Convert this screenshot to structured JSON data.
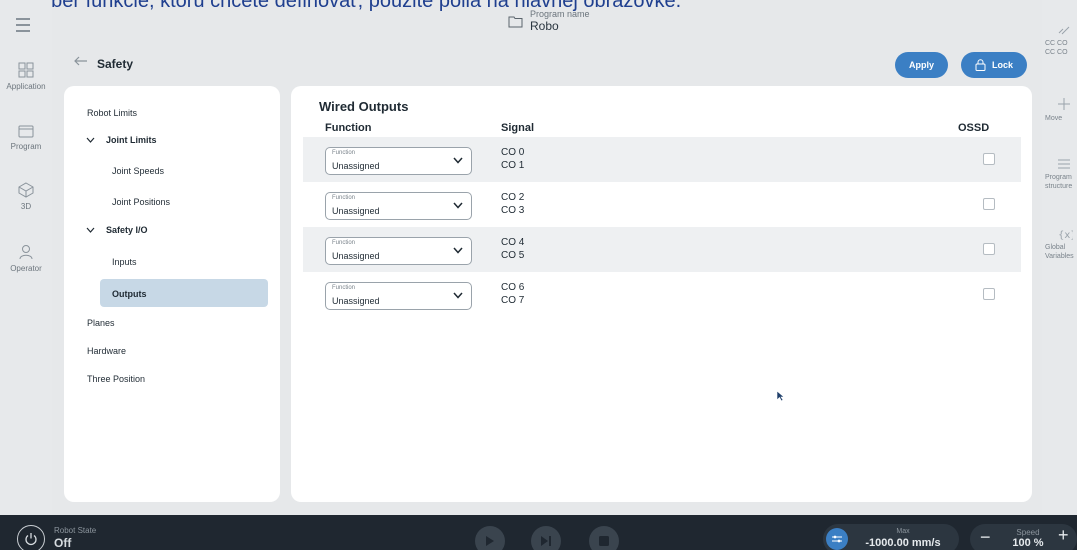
{
  "caption": "Na výber funkcie, ktorú chcete definovať, použite polia na hlavnej obrazovke.",
  "left_nav": {
    "items": [
      {
        "label": "Application",
        "icon": "grid-icon"
      },
      {
        "label": "Program",
        "icon": "folder-icon"
      },
      {
        "label": "3D",
        "icon": "cube-icon"
      },
      {
        "label": "Operator",
        "icon": "person-icon"
      }
    ]
  },
  "right_nav": {
    "items": [
      {
        "label": "CC CO\nCC CO",
        "icon": "link-icon"
      },
      {
        "label": "Move",
        "icon": "move-icon"
      },
      {
        "label": "Program\nstructure",
        "icon": "list-icon"
      },
      {
        "label": "Global\nVariables",
        "icon": "variable-icon"
      }
    ]
  },
  "program": {
    "label": "Program name",
    "value": "Robo"
  },
  "header": {
    "title": "Safety",
    "apply": "Apply",
    "lock": "Lock"
  },
  "tree": {
    "robot_limits": "Robot Limits",
    "joint_limits": "Joint Limits",
    "joint_speeds": "Joint Speeds",
    "joint_positions": "Joint Positions",
    "safety_io": "Safety I/O",
    "inputs": "Inputs",
    "outputs": "Outputs",
    "planes": "Planes",
    "hardware": "Hardware",
    "three_position": "Three Position"
  },
  "main": {
    "title": "Wired Outputs",
    "columns": {
      "function": "Function",
      "signal": "Signal",
      "ossd": "OSSD"
    },
    "rows": [
      {
        "function_label": "Function",
        "function_value": "Unassigned",
        "signal_a": "CO 0",
        "signal_b": "CO 1",
        "ossd": false
      },
      {
        "function_label": "Function",
        "function_value": "Unassigned",
        "signal_a": "CO 2",
        "signal_b": "CO 3",
        "ossd": false
      },
      {
        "function_label": "Function",
        "function_value": "Unassigned",
        "signal_a": "CO 4",
        "signal_b": "CO 5",
        "ossd": false
      },
      {
        "function_label": "Function",
        "function_value": "Unassigned",
        "signal_a": "CO 6",
        "signal_b": "CO 7",
        "ossd": false
      }
    ]
  },
  "bottom": {
    "robot_state_label": "Robot State",
    "robot_state_value": "Off",
    "max_label": "Max",
    "max_value": "-1000.00 mm/s",
    "speed_label": "Speed",
    "speed_value": "100 %"
  },
  "colors": {
    "accent": "#3b7fc4",
    "selected": "#c7d8e6",
    "bottom_bar": "#1f2730"
  }
}
